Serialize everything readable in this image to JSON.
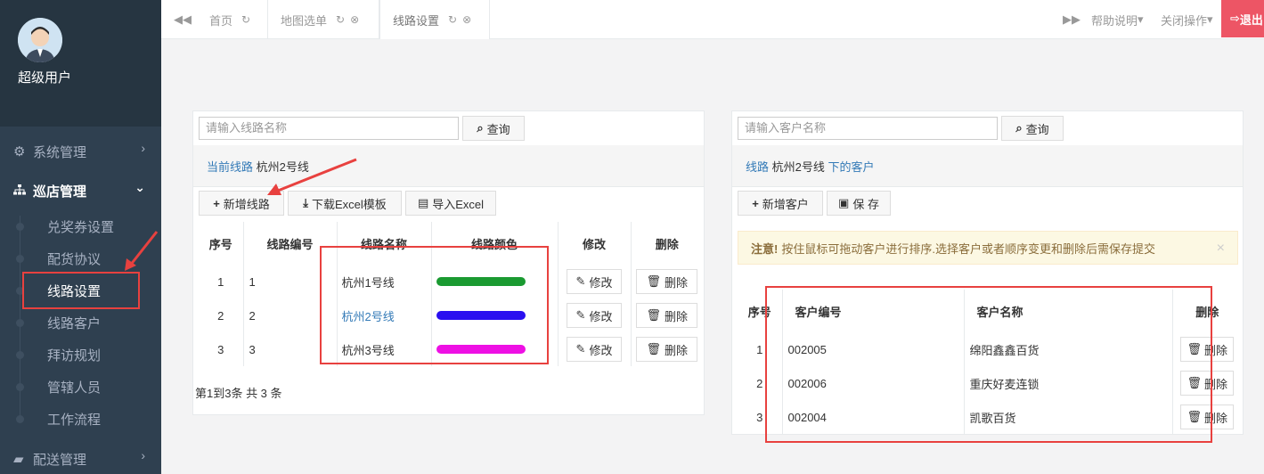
{
  "user": {
    "name": "超级用户"
  },
  "menu": [
    {
      "label": "系统管理",
      "icon": "cogs-icon",
      "glyph": "⚙"
    },
    {
      "label": "巡店管理",
      "icon": "sitemap-icon",
      "glyph": "♣"
    },
    {
      "label": "配送管理",
      "icon": "truck-icon",
      "glyph": "▰"
    }
  ],
  "submenu": [
    {
      "label": "兑奖券设置"
    },
    {
      "label": "配货协议"
    },
    {
      "label": "线路设置"
    },
    {
      "label": "线路客户"
    },
    {
      "label": "拜访规划"
    },
    {
      "label": "管辖人员"
    },
    {
      "label": "工作流程"
    }
  ],
  "tabs": [
    {
      "label": "首页"
    },
    {
      "label": "地图选单"
    },
    {
      "label": "线路设置"
    }
  ],
  "topbar": {
    "help": "帮助说明",
    "close_ops": "关闭操作",
    "logout": "退出"
  },
  "routes_panel": {
    "search_placeholder": "请输入线路名称",
    "search_btn": "查询",
    "crumb_label": "当前线路",
    "crumb_value": "杭州2号线",
    "buttons": {
      "add": "新增线路",
      "download": "下载Excel模板",
      "import": "导入Excel"
    },
    "headers": [
      "序号",
      "线路编号",
      "线路名称",
      "线路颜色",
      "修改",
      "删除"
    ],
    "rows": [
      {
        "seq": "1",
        "code": "1",
        "name": "杭州1号线",
        "color": "#1a9a31",
        "edit": "修改",
        "del": "删除"
      },
      {
        "seq": "2",
        "code": "2",
        "name": "杭州2号线",
        "color": "#2a0ff0",
        "edit": "修改",
        "del": "删除"
      },
      {
        "seq": "3",
        "code": "3",
        "name": "杭州3号线",
        "color": "#ee10e4",
        "edit": "修改",
        "del": "删除"
      }
    ],
    "pager": "第1到3条 共 3 条"
  },
  "customers_panel": {
    "search_placeholder": "请输入客户名称",
    "search_btn": "查询",
    "crumb_prefix": "线路",
    "crumb_value": "杭州2号线",
    "crumb_suffix": "下的客户",
    "buttons": {
      "add": "新增客户",
      "save": "保 存"
    },
    "alert_title": "注意!",
    "alert_text": "按住鼠标可拖动客户进行排序.选择客户或者顺序变更和删除后需保存提交",
    "headers": [
      "序号",
      "客户编号",
      "客户名称",
      "删除"
    ],
    "rows": [
      {
        "seq": "1",
        "code": "002005",
        "name": "绵阳鑫鑫百货",
        "del": "删除"
      },
      {
        "seq": "2",
        "code": "002006",
        "name": "重庆好麦连锁",
        "del": "删除"
      },
      {
        "seq": "3",
        "code": "002004",
        "name": "凯歌百货",
        "del": "删除"
      }
    ]
  },
  "colors": {
    "sidebar": "#2f4050",
    "accent": "#337ab7",
    "annotation": "#e8413f"
  }
}
